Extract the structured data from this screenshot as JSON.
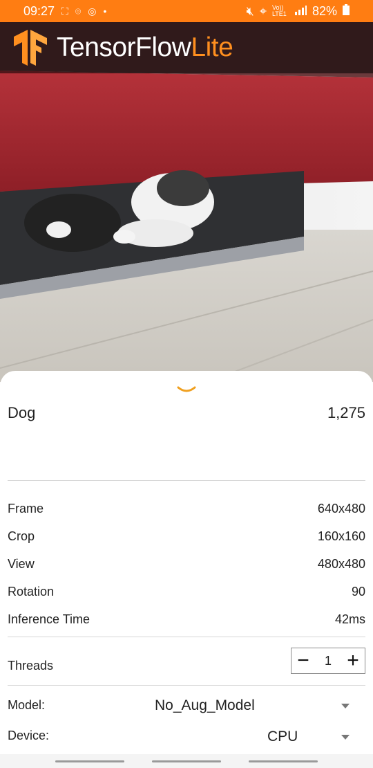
{
  "status_bar": {
    "time": "09:27",
    "battery": "82%",
    "network": "Vo)) LTE1",
    "icons": [
      "screenshot-icon",
      "scan-icon",
      "vpn-icon",
      "dot-icon",
      "mute-icon",
      "location-icon",
      "signal-icon",
      "battery-icon"
    ]
  },
  "app_header": {
    "brand": "TensorFlow",
    "brand_suffix": "Lite",
    "accent_color": "#ff8f1f",
    "status_color": "#ff7d12"
  },
  "result": {
    "label": "Dog",
    "score": "1,275"
  },
  "info": [
    {
      "label": "Frame",
      "value": "640x480"
    },
    {
      "label": "Crop",
      "value": "160x160"
    },
    {
      "label": "View",
      "value": "480x480"
    },
    {
      "label": "Rotation",
      "value": "90"
    },
    {
      "label": "Inference Time",
      "value": "42ms"
    }
  ],
  "threads": {
    "label": "Threads",
    "value": "1",
    "minus": "−",
    "plus": "+"
  },
  "model": {
    "label": "Model:",
    "value": "No_Aug_Model"
  },
  "device": {
    "label": "Device:",
    "value": "CPU"
  }
}
